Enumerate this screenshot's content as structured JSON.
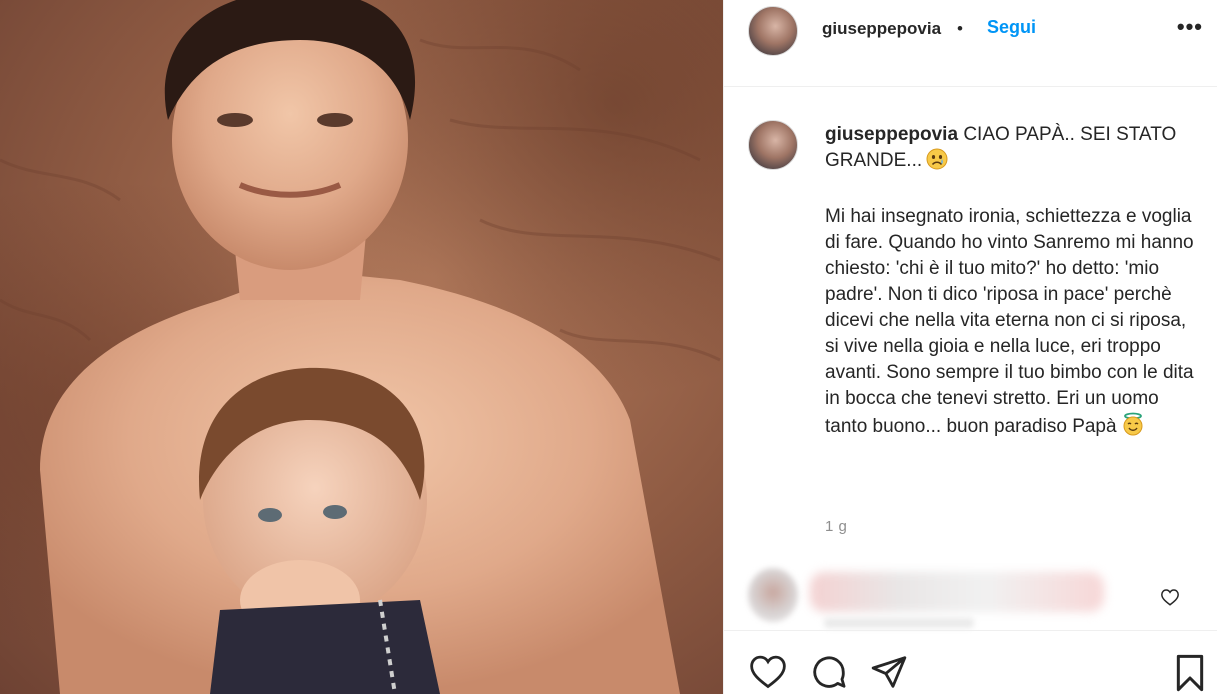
{
  "post": {
    "username": "giuseppepovia",
    "separator": "•",
    "follow_label": "Segui",
    "more_label": "•••"
  },
  "caption": {
    "username": "giuseppepovia",
    "first_line": "CIAO PAPÀ.. SEI STATO GRANDE...",
    "first_emoji": "sad-face-emoji",
    "body": "Mi hai insegnato ironia, schiettezza e voglia di fare. Quando ho vinto Sanremo mi hanno chiesto: 'chi è il tuo mito?' ho detto: 'mio padre'. Non ti dico 'riposa in pace' perchè dicevi che nella vita eterna non ci si riposa, si vive nella gioia e nella luce, eri troppo avanti. Sono sempre il tuo bimbo con le dita in bocca che tenevi stretto. Eri un uomo tanto buono... buon paradiso Papà",
    "last_emoji": "angel-face-emoji",
    "timestamp": "1 g"
  },
  "icons": {
    "like": "heart-icon",
    "comment": "comment-icon",
    "share": "paper-plane-icon",
    "save": "bookmark-icon",
    "comment_like": "heart-icon"
  },
  "colors": {
    "accent": "#0095f6",
    "text": "#262626",
    "muted": "#8e8e8e",
    "border": "#efefef"
  }
}
